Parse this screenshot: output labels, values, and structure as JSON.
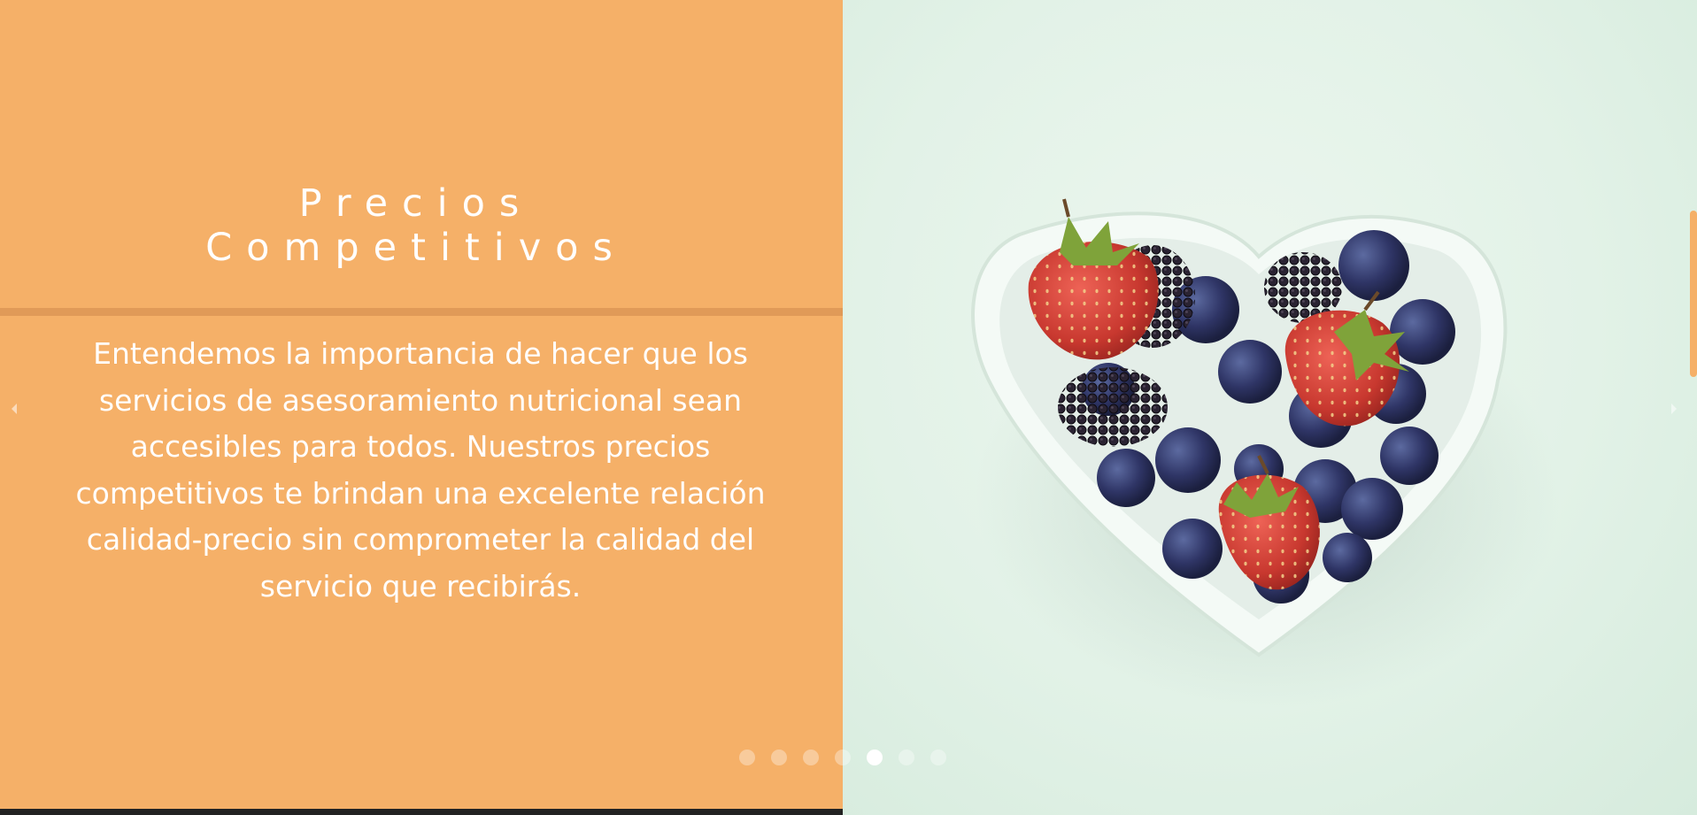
{
  "slide": {
    "title_line1": "Precios",
    "title_line2": "Competitivos",
    "description": "Entendemos la importancia de hacer que los servicios de asesoramiento nutricional sean accesibles para todos. Nuestros precios competitivos te brindan una excelente relación calidad-precio sin comprometer la calidad del servicio que recibirás."
  },
  "image": {
    "alt": "Bowl en forma de corazón con fresas, moras y arándanos"
  },
  "pagination": {
    "total": 7,
    "active_index": 4
  },
  "colors": {
    "panel": "#f5b068",
    "divider": "#e09a58",
    "background": "#e2f2e7"
  },
  "icons": {
    "prev": "chevron-left-icon",
    "next": "chevron-right-icon"
  }
}
